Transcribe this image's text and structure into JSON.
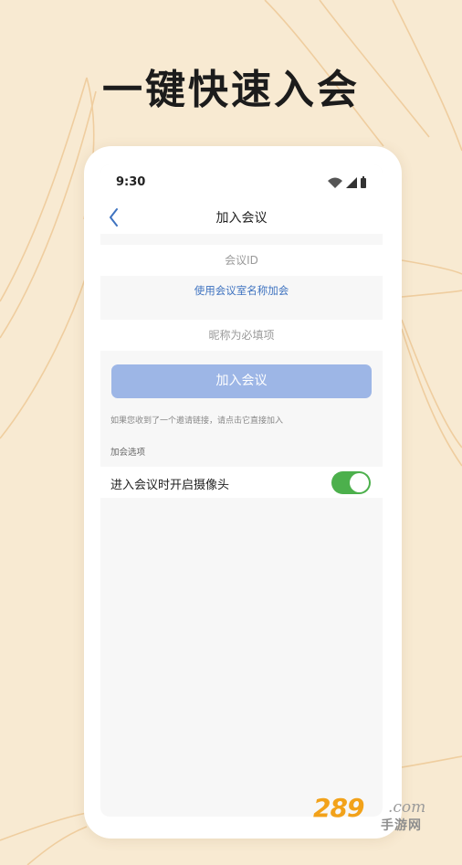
{
  "headline": "一键快速入会",
  "status": {
    "time": "9:30"
  },
  "nav": {
    "title": "加入会议"
  },
  "meeting_id": {
    "placeholder": "会议ID"
  },
  "room_name_link": "使用会议室名称加会",
  "nickname": {
    "placeholder": "昵称为必填项"
  },
  "join_button": "加入会议",
  "hint": "如果您收到了一个邀请链接，请点击它直接加入",
  "options": {
    "section_label": "加会选项",
    "camera_label": "进入会议时开启摄像头",
    "camera_on": true
  },
  "watermark": {
    "number": "289",
    "suffix": ".com",
    "cn": "手游网"
  },
  "colors": {
    "background": "#f8ead2",
    "link": "#3f73c0",
    "button": "#9db6e6",
    "toggle_on": "#4cb04c",
    "watermark_orange": "#f2a21a"
  }
}
